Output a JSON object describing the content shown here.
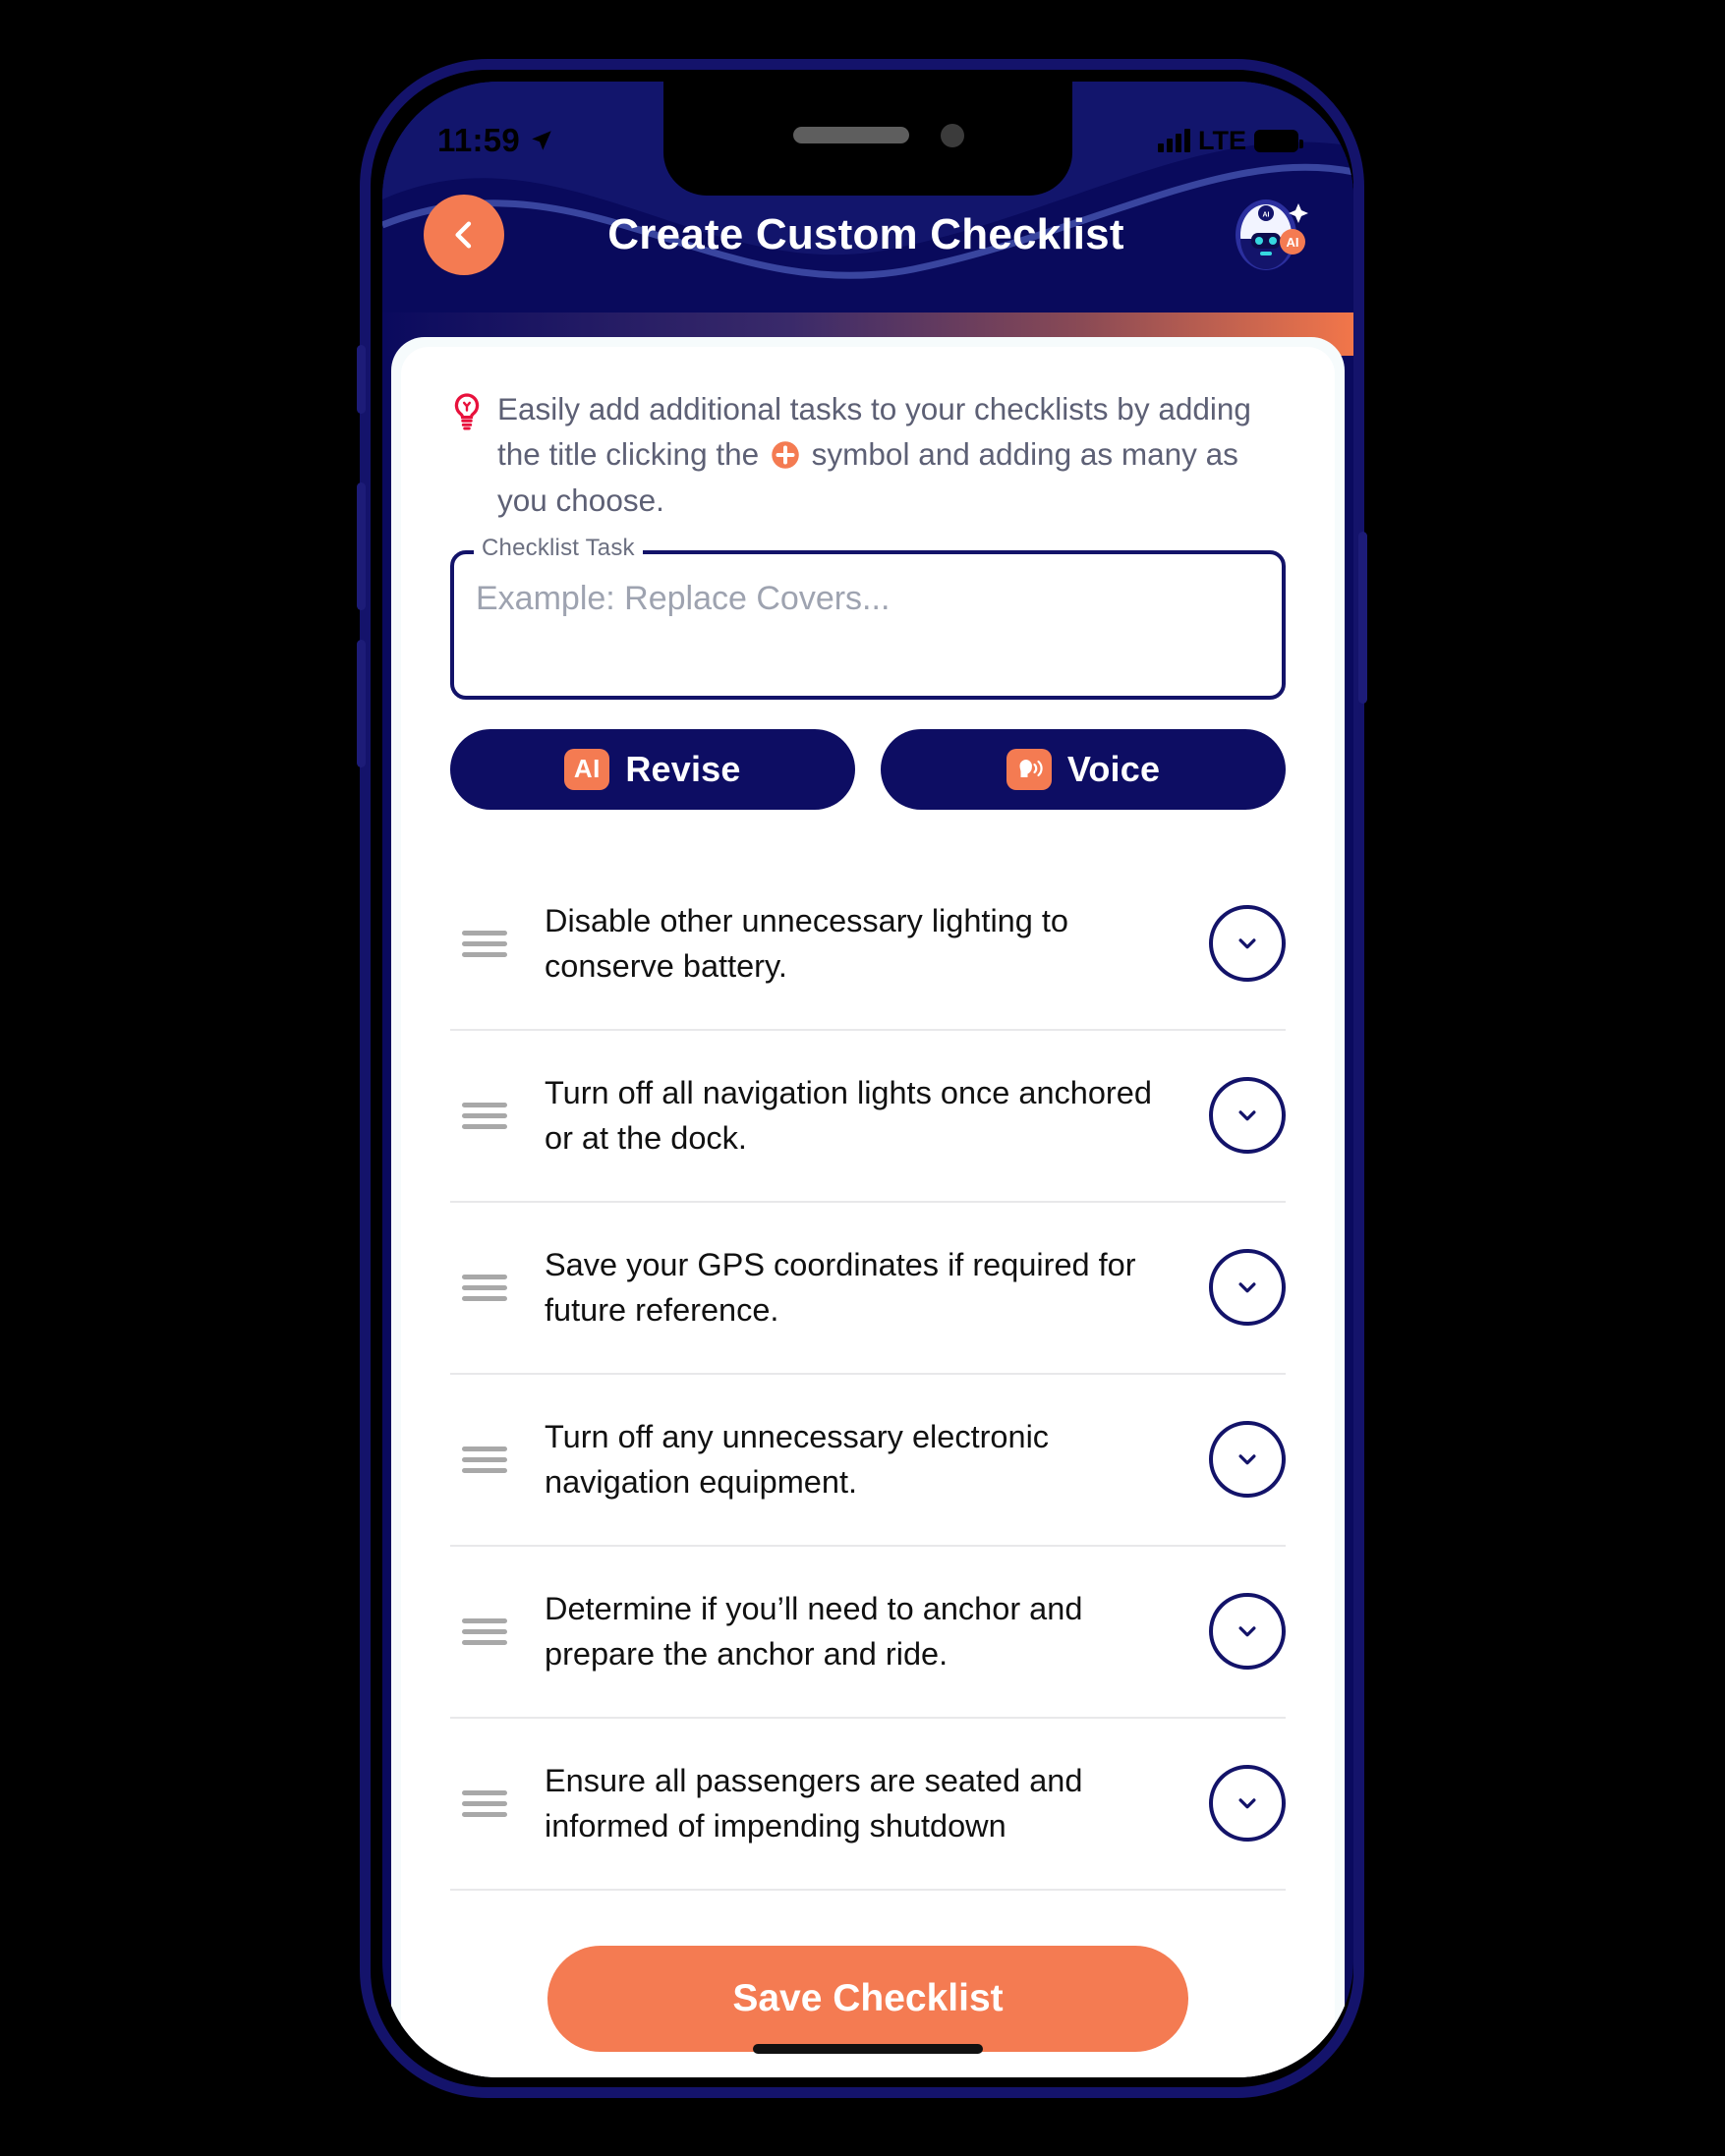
{
  "status_bar": {
    "time": "11:59",
    "location_icon": "location-arrow-icon",
    "network": "LTE",
    "signal_icon": "signal-bars-icon",
    "battery_icon": "battery-icon"
  },
  "header": {
    "title": "Create Custom Checklist",
    "back_icon": "chevron-left-icon",
    "assistant_icon": "ai-robot-avatar-icon",
    "assistant_badge": "AI",
    "background_color": "#090a5c",
    "accent_color": "#f47b52"
  },
  "tip": {
    "icon": "lightbulb-icon",
    "part1": "Easily add additional tasks to your checklists by adding the title clicking the",
    "inline_icon": "plus-circle-icon",
    "part2": "symbol and adding as many as you choose.",
    "text_color": "#5d6075",
    "icon_color": "#e8113c"
  },
  "task_input": {
    "label": "Checklist Task",
    "placeholder": "Example: Replace Covers...",
    "value": "",
    "border_color": "#131369"
  },
  "actions": [
    {
      "label": "Revise",
      "badge_text": "AI",
      "badge_icon": "ai-badge-icon",
      "name": "revise-button"
    },
    {
      "label": "Voice",
      "badge_text": "",
      "badge_icon": "voice-speaking-icon",
      "name": "voice-button"
    }
  ],
  "tasks": [
    {
      "text": "Disable other unnecessary lighting to conserve battery.",
      "drag_icon": "drag-handle-icon",
      "expand_icon": "chevron-down-icon"
    },
    {
      "text": "Turn off all navigation lights once anchored or at the dock.",
      "drag_icon": "drag-handle-icon",
      "expand_icon": "chevron-down-icon"
    },
    {
      "text": "Save your GPS coordinates if required for future reference.",
      "drag_icon": "drag-handle-icon",
      "expand_icon": "chevron-down-icon"
    },
    {
      "text": "Turn off any unnecessary electronic navigation equipment.",
      "drag_icon": "drag-handle-icon",
      "expand_icon": "chevron-down-icon"
    },
    {
      "text": "Determine if you’ll need to anchor and prepare the anchor and ride.",
      "drag_icon": "drag-handle-icon",
      "expand_icon": "chevron-down-icon"
    },
    {
      "text": "Ensure all passengers are seated and informed of impending shutdown",
      "drag_icon": "drag-handle-icon",
      "expand_icon": "chevron-down-icon"
    }
  ],
  "save": {
    "label": "Save Checklist",
    "color": "#f47b52"
  }
}
